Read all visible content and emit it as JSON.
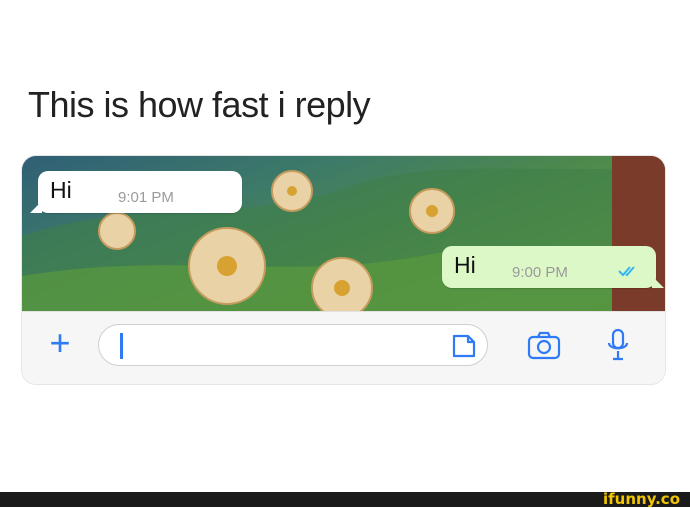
{
  "caption": "This is how fast i reply",
  "chat": {
    "incoming": {
      "text": "Hi",
      "time": "9:01 PM"
    },
    "outgoing": {
      "text": "Hi",
      "time": "9:00 PM",
      "status_icon": "double-check-read-icon"
    }
  },
  "input_bar": {
    "plus_icon": "+",
    "field_value": "",
    "icons": [
      "plus-icon",
      "sticker-icon",
      "camera-icon",
      "microphone-icon"
    ]
  },
  "colors": {
    "accent": "#2f7bf6",
    "outgoing_bubble": "#dcf8c6",
    "incoming_bubble": "#ffffff",
    "watermark": "#f2c500"
  },
  "watermark": "ifunny.co"
}
